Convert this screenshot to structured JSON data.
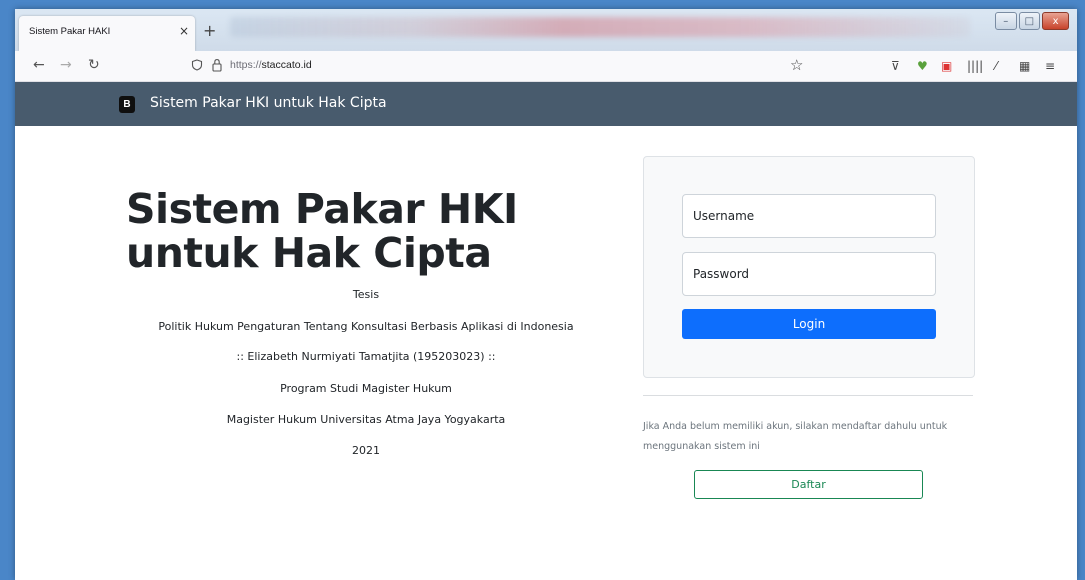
{
  "browser": {
    "tab_title": "Sistem Pakar HAKI",
    "tab_close": "×",
    "new_tab": "+",
    "url_scheme": "https://",
    "url_host": "staccato.id",
    "win_min": "–",
    "win_max": "□",
    "win_close": "x"
  },
  "navbar": {
    "brand_logo": "B",
    "brand_text": "Sistem Pakar HKI untuk Hak Cipta"
  },
  "hero": {
    "title_line1": "Sistem Pakar HKI",
    "title_line2": "untuk Hak Cipta",
    "lines": [
      "Tesis",
      "Politik Hukum Pengaturan Tentang Konsultasi Berbasis Aplikasi di Indonesia",
      ":: Elizabeth Nurmiyati Tamatjita (195203023) ::",
      "Program Studi Magister Hukum",
      "Magister Hukum Universitas Atma Jaya Yogyakarta",
      "2021"
    ]
  },
  "login": {
    "username_placeholder": "Username",
    "password_placeholder": "Password",
    "login_label": "Login"
  },
  "register": {
    "note": "Jika Anda belum memiliki akun, silakan mendaftar dahulu untuk menggunakan sistem ini",
    "button_label": "Daftar"
  },
  "colors": {
    "navbar_bg": "#485b6d",
    "primary": "#0d6efd",
    "success": "#198754",
    "desktop_bg": "#4a86c8"
  }
}
